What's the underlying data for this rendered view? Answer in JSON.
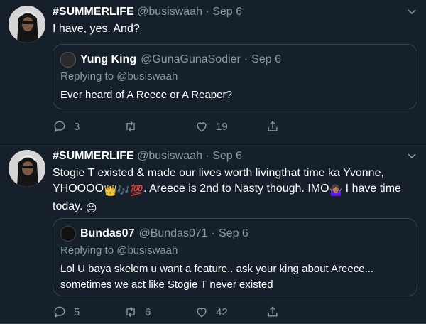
{
  "tweets": [
    {
      "name": "#SUMMERLIFE",
      "handle": "@busiswaah",
      "sep": "·",
      "date": "Sep 6",
      "text": "I have, yes. And?",
      "quote": {
        "name": "Yung King",
        "handle": "@GunaGunaSodier",
        "sep": "·",
        "date": "Sep 6",
        "replying": "Replying to @busiswaah",
        "text": "Ever heard of A Reece or A Reaper?"
      },
      "actions": {
        "replies": "3",
        "retweets": "",
        "likes": "19"
      }
    },
    {
      "name": "#SUMMERLIFE",
      "handle": "@busiswaah",
      "sep": "·",
      "date": "Sep 6",
      "text_parts": {
        "line1": "Stogie T existed & made our lives worth livingthat time ka Yvonne,",
        "line2a": "YHOOOO",
        "line2b": ". Areece is 2nd to Nasty though. IMO",
        "line2c": " I have time",
        "line3": "today. "
      },
      "emoji": {
        "crown": "👑",
        "notes": "🎶",
        "hundred": "💯",
        "shrug": "🤷🏽‍♀️",
        "neutral": "😐"
      },
      "quote": {
        "name": "Bundas07",
        "handle": "@Bundas071",
        "sep": "·",
        "date": "Sep 6",
        "replying": "Replying to @busiswaah",
        "text": "Lol U baya skelem u want a feature.. ask your king about Areece... sometimes we act like Stogie T never existed"
      },
      "actions": {
        "replies": "5",
        "retweets": "6",
        "likes": "42"
      }
    }
  ],
  "colors": {
    "background": "#15202b",
    "muted": "#8899a6",
    "border": "#38444d",
    "text": "#ffffff"
  },
  "icons": [
    "reply-icon",
    "retweet-icon",
    "like-icon",
    "share-icon",
    "chevron-down-icon"
  ]
}
